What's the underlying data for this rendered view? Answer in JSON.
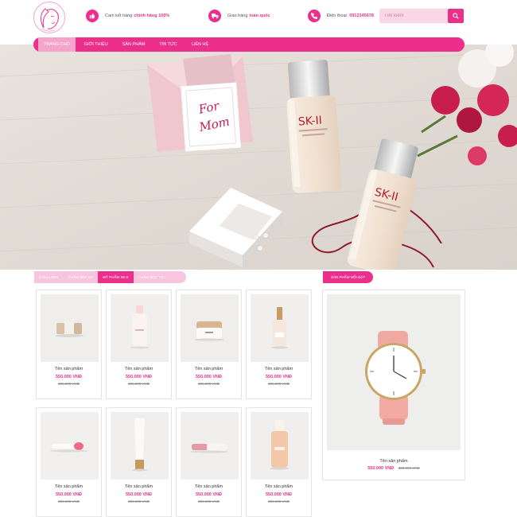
{
  "header": {
    "logo_icon": "woman-face-logo",
    "info": [
      {
        "icon": "thumbs-up-icon",
        "text": "Cam kết hàng",
        "highlight": "chính hãng 100%"
      },
      {
        "icon": "truck-icon",
        "text": "Giao hàng",
        "highlight": "toàn quốc"
      },
      {
        "icon": "phone-icon",
        "text": "Điện thoại:",
        "highlight": "0912345678"
      }
    ],
    "search_placeholder": "Tìm kiếm",
    "search_icon": "search-icon"
  },
  "nav": {
    "items": [
      "TRANG CHỦ",
      "GIỚI THIỆU",
      "SẢN PHẨM",
      "TIN TỨC",
      "LIÊN HỆ"
    ],
    "active_index": 0
  },
  "banner": {
    "card_text_line1": "For",
    "card_text_line2": "Mom",
    "bottle_brand": "SK-II"
  },
  "tabs": {
    "items": [
      "COLLAGEN",
      "CHĂM SÓC DA",
      "MỸ PHẨM SK-II",
      "CHĂM SÓC TÓC"
    ],
    "active_index": 2
  },
  "hot_section_title": "SẢN PHẨM NỔI BẬT",
  "products": [
    {
      "name": "Tên sản phẩm",
      "price": "550.000 VNĐ",
      "old_price": "300.000 VNĐ"
    },
    {
      "name": "Tên sản phẩm",
      "price": "550.000 VNĐ",
      "old_price": "300.000 VNĐ"
    },
    {
      "name": "Tên sản phẩm",
      "price": "550.000 VNĐ",
      "old_price": "300.000 VNĐ"
    },
    {
      "name": "Tên sản phẩm",
      "price": "550.000 VNĐ",
      "old_price": "300.000 VNĐ"
    },
    {
      "name": "Tên sản phẩm",
      "price": "550.000 VNĐ",
      "old_price": "300.000 VNĐ"
    },
    {
      "name": "Tên sản phẩm",
      "price": "550.000 VNĐ",
      "old_price": "300.000 VNĐ"
    },
    {
      "name": "Tên sản phẩm",
      "price": "550.000 VNĐ",
      "old_price": "300.000 VNĐ"
    },
    {
      "name": "Tên sản phẩm",
      "price": "550.000 VNĐ",
      "old_price": "300.000 VNĐ"
    }
  ],
  "hot_product": {
    "name": "Tên sản phẩm",
    "price": "550.000 VNĐ",
    "old_price": "300.000 VNĐ"
  },
  "colors": {
    "accent": "#ec2f8b",
    "accent_light": "#f7c6de"
  }
}
